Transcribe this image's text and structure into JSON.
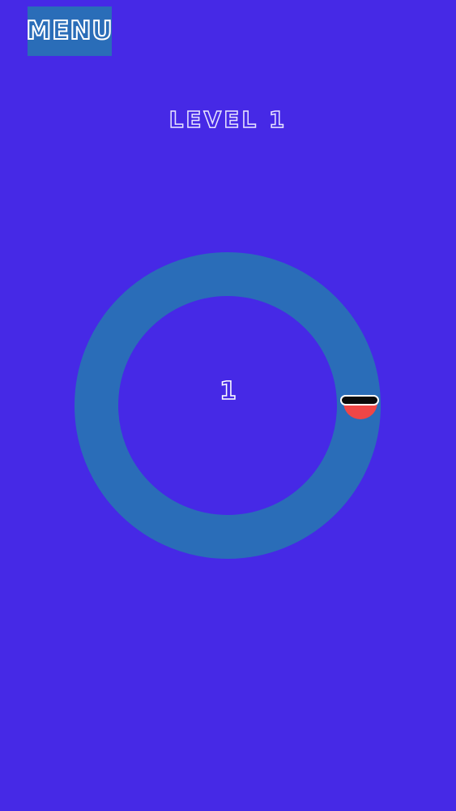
{
  "menu": {
    "label": "MENU"
  },
  "level": {
    "title": "LEVEL 1"
  },
  "game": {
    "counter": "1",
    "colors": {
      "background": "#4629e6",
      "ring": "#2a6db8",
      "player": "#f04646",
      "target_bar": "#0a0a0a",
      "target_outline": "#ffffff",
      "text": "#ffffff"
    }
  }
}
